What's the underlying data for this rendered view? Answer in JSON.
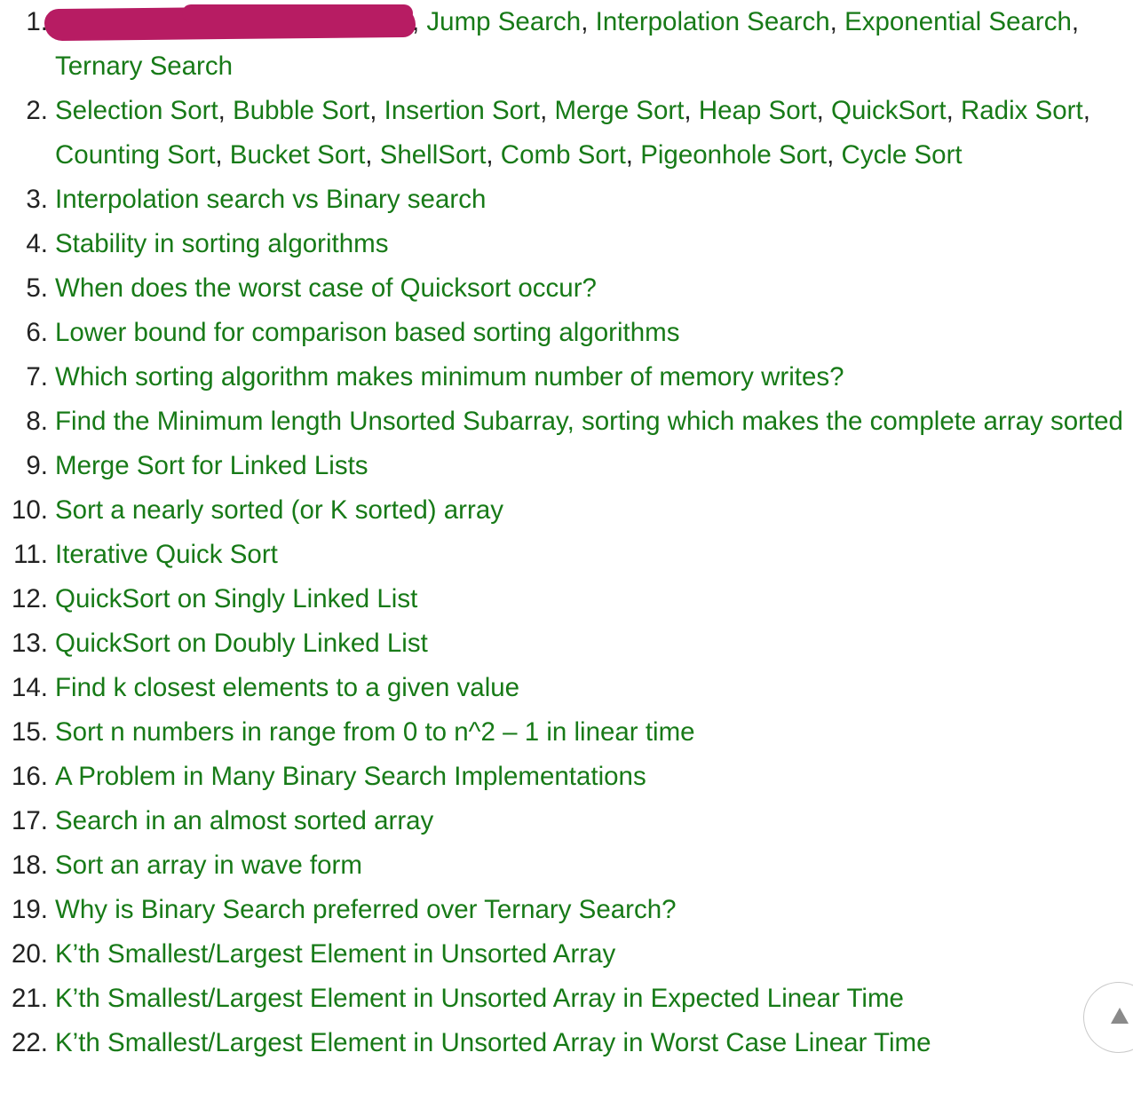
{
  "items": [
    {
      "number": "1.",
      "links": [
        "Jump Search",
        "Interpolation Search",
        "Exponential Search",
        "Ternary Search"
      ],
      "redacted": true
    },
    {
      "number": "2.",
      "links": [
        "Selection Sort",
        "Bubble Sort",
        "Insertion Sort",
        "Merge Sort",
        "Heap Sort",
        "QuickSort",
        "Radix Sort",
        "Counting Sort",
        "Bucket Sort",
        "ShellSort",
        "Comb Sort",
        "Pigeonhole Sort",
        "Cycle Sort"
      ]
    },
    {
      "number": "3.",
      "links": [
        "Interpolation search vs Binary search"
      ]
    },
    {
      "number": "4.",
      "links": [
        "Stability in sorting algorithms"
      ]
    },
    {
      "number": "5.",
      "links": [
        "When does the worst case of Quicksort occur?"
      ]
    },
    {
      "number": "6.",
      "links": [
        "Lower bound for comparison based sorting algorithms"
      ]
    },
    {
      "number": "7.",
      "links": [
        "Which sorting algorithm makes minimum number of memory writes?"
      ]
    },
    {
      "number": "8.",
      "links": [
        "Find the Minimum length Unsorted Subarray, sorting which makes the complete array sorted"
      ]
    },
    {
      "number": "9.",
      "links": [
        "Merge Sort for Linked Lists"
      ]
    },
    {
      "number": "10.",
      "links": [
        "Sort a nearly sorted (or K sorted) array"
      ]
    },
    {
      "number": "11.",
      "links": [
        "Iterative Quick Sort"
      ]
    },
    {
      "number": "12.",
      "links": [
        "QuickSort on Singly Linked List"
      ]
    },
    {
      "number": "13.",
      "links": [
        "QuickSort on Doubly Linked List"
      ]
    },
    {
      "number": "14.",
      "links": [
        "Find k closest elements to a given value"
      ]
    },
    {
      "number": "15.",
      "links": [
        "Sort n numbers in range from 0 to n^2 – 1 in linear time"
      ]
    },
    {
      "number": "16.",
      "links": [
        "A Problem in Many Binary Search Implementations"
      ]
    },
    {
      "number": "17.",
      "links": [
        "Search in an almost sorted array"
      ]
    },
    {
      "number": "18.",
      "links": [
        "Sort an array in wave form"
      ]
    },
    {
      "number": "19.",
      "links": [
        "Why is Binary Search preferred over Ternary Search?"
      ]
    },
    {
      "number": "20.",
      "links": [
        "K’th Smallest/Largest Element in Unsorted Array"
      ]
    },
    {
      "number": "21.",
      "links": [
        "K’th Smallest/Largest Element in Unsorted Array in Expected Linear Time"
      ]
    },
    {
      "number": "22.",
      "links": [
        "K’th Smallest/Largest Element in Unsorted Array in Worst Case Linear Time"
      ]
    }
  ],
  "separator": ", ",
  "scroll_top": {
    "icon": "▲"
  },
  "colors": {
    "link": "#177a17",
    "text": "#222222",
    "redaction": "#b71c63"
  }
}
